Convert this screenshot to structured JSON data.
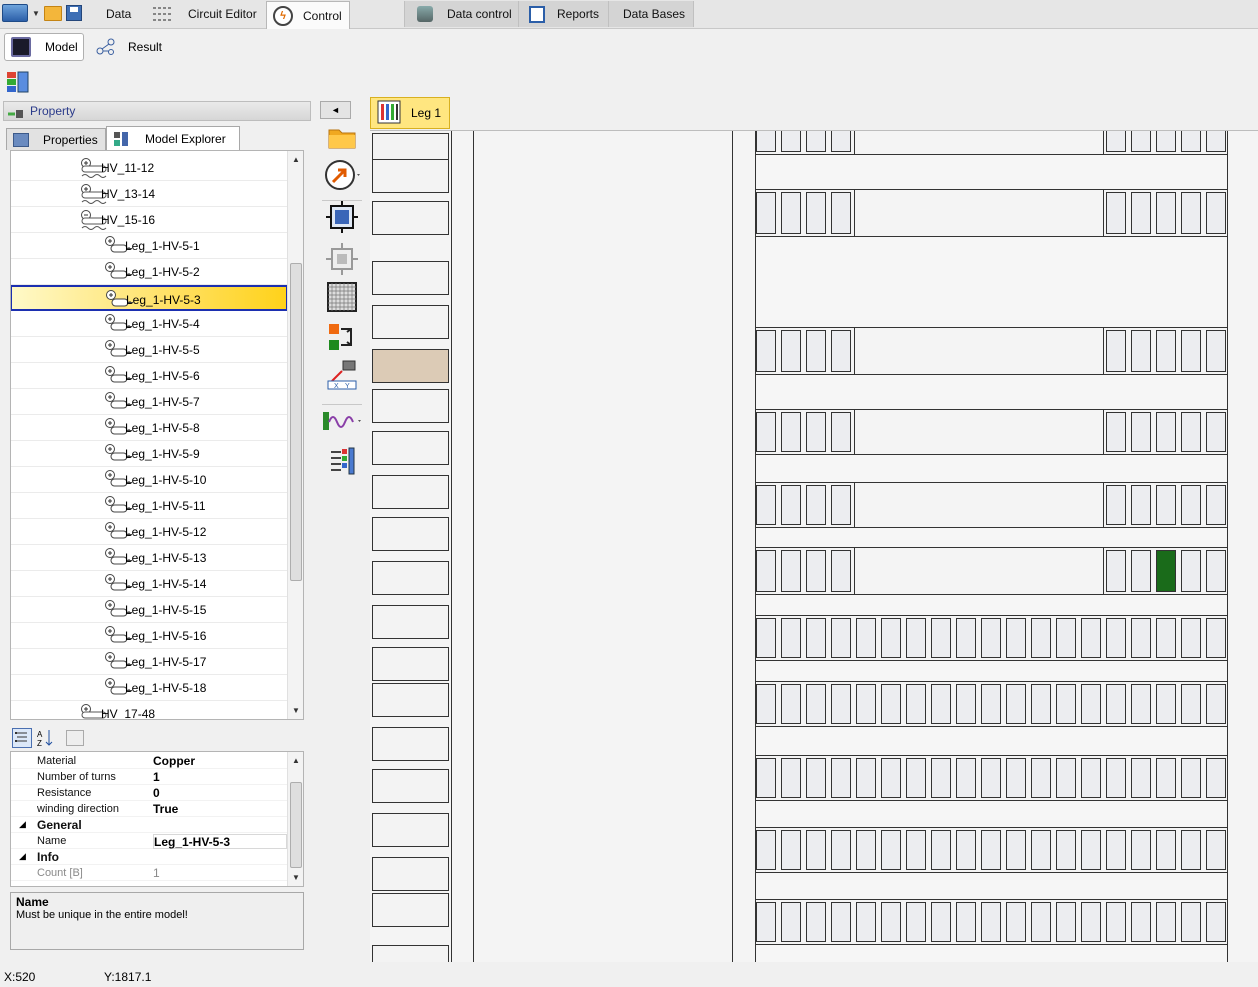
{
  "top_tabs": {
    "data": "Data",
    "circuit_editor": "Circuit Editor",
    "control": "Control",
    "data_control": "Data control",
    "reports": "Reports",
    "data_bases": "Data Bases"
  },
  "sub_tabs": {
    "model": "Model",
    "result": "Result"
  },
  "property_header": "Property",
  "panel_tabs": {
    "properties": "Properties",
    "model_explorer": "Model Explorer"
  },
  "tree": {
    "items": [
      {
        "label": "HV_11-12",
        "level": 1,
        "expanded": false
      },
      {
        "label": "HV_13-14",
        "level": 1,
        "expanded": false
      },
      {
        "label": "HV_15-16",
        "level": 1,
        "expanded": true
      },
      {
        "label": "Leg_1-HV-5-1",
        "level": 2
      },
      {
        "label": "Leg_1-HV-5-2",
        "level": 2
      },
      {
        "label": "Leg_1-HV-5-3",
        "level": 2,
        "selected": true
      },
      {
        "label": "Leg_1-HV-5-4",
        "level": 2
      },
      {
        "label": "Leg_1-HV-5-5",
        "level": 2
      },
      {
        "label": "Leg_1-HV-5-6",
        "level": 2
      },
      {
        "label": "Leg_1-HV-5-7",
        "level": 2
      },
      {
        "label": "Leg_1-HV-5-8",
        "level": 2
      },
      {
        "label": "Leg_1-HV-5-9",
        "level": 2
      },
      {
        "label": "Leg_1-HV-5-10",
        "level": 2
      },
      {
        "label": "Leg_1-HV-5-11",
        "level": 2
      },
      {
        "label": "Leg_1-HV-5-12",
        "level": 2
      },
      {
        "label": "Leg_1-HV-5-13",
        "level": 2
      },
      {
        "label": "Leg_1-HV-5-14",
        "level": 2
      },
      {
        "label": "Leg_1-HV-5-15",
        "level": 2
      },
      {
        "label": "Leg_1-HV-5-16",
        "level": 2
      },
      {
        "label": "Leg_1-HV-5-17",
        "level": 2
      },
      {
        "label": "Leg_1-HV-5-18",
        "level": 2
      },
      {
        "label": "HV_17-48",
        "level": 1,
        "expanded": false
      }
    ]
  },
  "property_grid": {
    "rows": [
      {
        "kind": "prop",
        "name": "Material",
        "value": "Copper"
      },
      {
        "kind": "prop",
        "name": "Number of turns",
        "value": "1"
      },
      {
        "kind": "prop",
        "name": "Resistance",
        "value": "0"
      },
      {
        "kind": "prop",
        "name": "winding direction",
        "value": "True"
      },
      {
        "kind": "category",
        "name": "General",
        "value": ""
      },
      {
        "kind": "edit",
        "name": "Name",
        "value": "Leg_1-HV-5-3"
      },
      {
        "kind": "category",
        "name": "Info",
        "value": ""
      },
      {
        "kind": "disabled",
        "name": "Count [B]",
        "value": "1"
      }
    ]
  },
  "description": {
    "title": "Name",
    "text": "Must be unique in the entire model!"
  },
  "status": {
    "x": "X:520",
    "y": "Y:1817.1"
  },
  "canvas": {
    "tab_label": "Leg 1",
    "colors": {
      "frame": "#333333",
      "cell": "#ecedf0",
      "highlight_cell": "#1a6b1a",
      "tab": "#ffe680"
    }
  }
}
